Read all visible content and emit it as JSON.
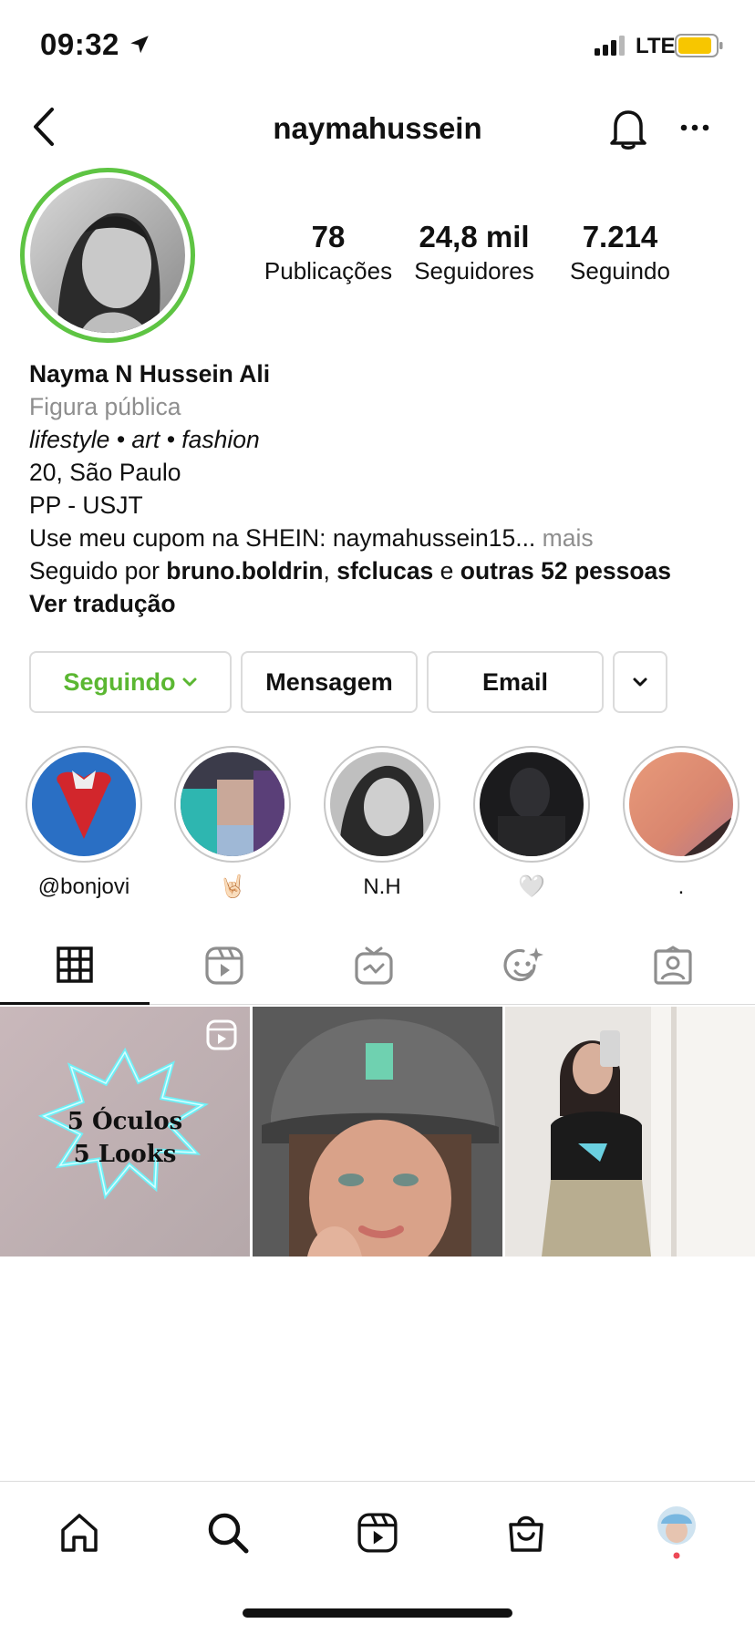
{
  "status_bar": {
    "time": "09:32",
    "network": "LTE",
    "icons": [
      "location-arrow-icon",
      "signal-icon",
      "battery-icon"
    ]
  },
  "header": {
    "username": "naymahussein",
    "icons": [
      "back-icon",
      "bell-icon",
      "more-icon"
    ]
  },
  "profile": {
    "stats": [
      {
        "value": "78",
        "label": "Publicações"
      },
      {
        "value": "24,8 mil",
        "label": "Seguidores"
      },
      {
        "value": "7.214",
        "label": "Seguindo"
      }
    ],
    "name": "Nayma N Hussein Ali",
    "category": "Figura pública",
    "tags": "lifestyle • art  • fashion",
    "bio_line1": "20, São Paulo",
    "bio_line2": "PP - USJT",
    "bio_line3": "Use meu cupom na SHEIN: naymahussein15...",
    "more": " mais",
    "followed_by_prefix": "Seguido por ",
    "followed_by_user1": "bruno.boldrin",
    "followed_by_sep": ", ",
    "followed_by_user2": "sfclucas",
    "followed_by_and": " e ",
    "followed_by_others": "outras 52 pessoas",
    "translate": "Ver tradução"
  },
  "actions": {
    "following": "Seguindo",
    "message": "Mensagem",
    "email": "Email"
  },
  "highlights": [
    {
      "label": "@bonjovi"
    },
    {
      "label": "🤘🏻"
    },
    {
      "label": "N.H"
    },
    {
      "label": "🤍"
    },
    {
      "label": "."
    }
  ],
  "grid_posts": [
    {
      "text_line1": "5 Óculos",
      "text_line2": "5 Looks",
      "type": "reel"
    },
    {
      "type": "photo"
    },
    {
      "type": "photo"
    }
  ],
  "tabs": [
    "grid-icon",
    "reels-icon",
    "igtv-icon",
    "effects-icon",
    "tagged-icon"
  ],
  "bottom_nav": [
    "home-icon",
    "search-icon",
    "reels-icon",
    "shop-icon",
    "profile-avatar"
  ],
  "colors": {
    "accent_green": "#5bb732",
    "ring_green": "#5ec443",
    "muted": "#8e8e8e",
    "border": "#dbdbdb",
    "notification_dot": "#ed4956",
    "battery": "#f7c600"
  }
}
